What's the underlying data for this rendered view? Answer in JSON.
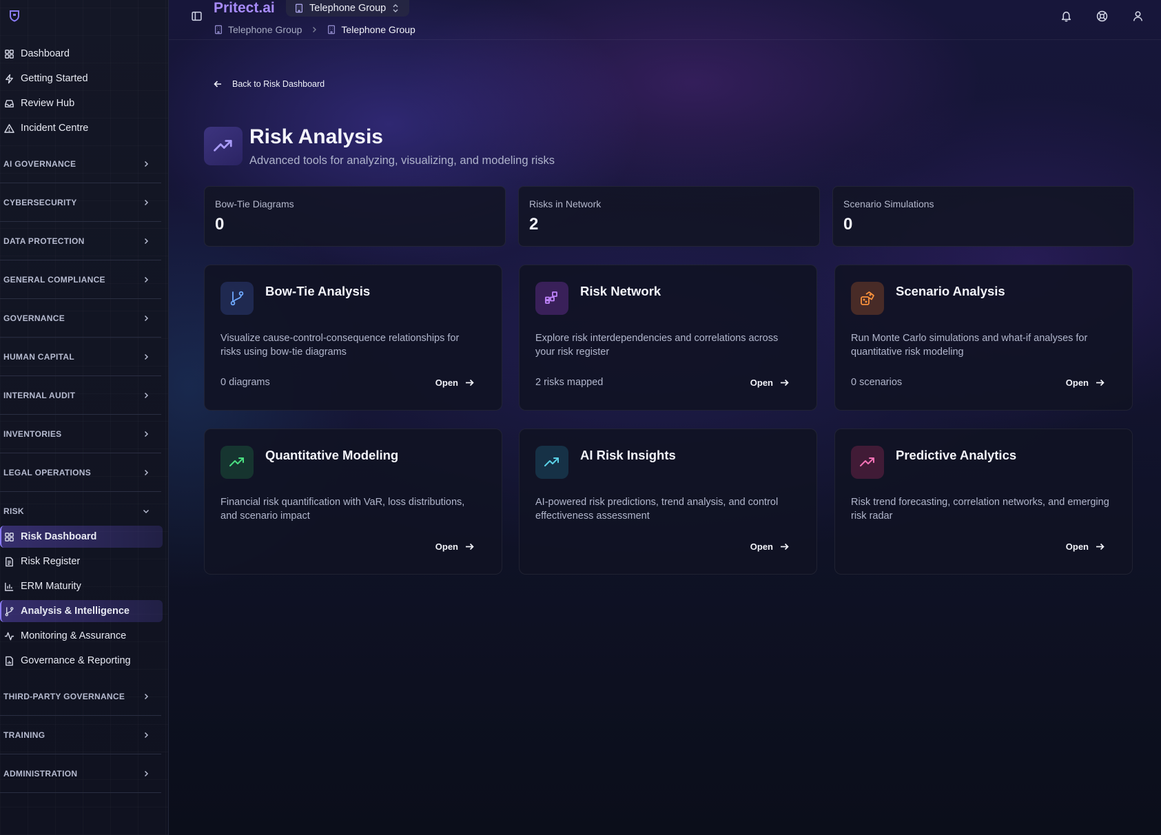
{
  "sidebar": {
    "top_items": [
      {
        "label": "Dashboard",
        "icon": "grid-icon"
      },
      {
        "label": "Getting Started",
        "icon": "zap-icon"
      },
      {
        "label": "Review Hub",
        "icon": "inbox-icon"
      },
      {
        "label": "Incident Centre",
        "icon": "alert-triangle-icon"
      }
    ],
    "sections": [
      "AI GOVERNANCE",
      "CYBERSECURITY",
      "DATA PROTECTION",
      "GENERAL COMPLIANCE",
      "GOVERNANCE",
      "HUMAN CAPITAL",
      "INTERNAL AUDIT",
      "INVENTORIES",
      "LEGAL OPERATIONS",
      "RISK",
      "THIRD-PARTY GOVERNANCE",
      "TRAINING",
      "ADMINISTRATION"
    ],
    "risk_items": [
      {
        "label": "Risk Dashboard",
        "icon": "grid-icon",
        "active": true
      },
      {
        "label": "Risk Register",
        "icon": "file-text-icon"
      },
      {
        "label": "ERM Maturity",
        "icon": "bar-chart-icon"
      },
      {
        "label": "Analysis & Intelligence",
        "icon": "git-branch-icon",
        "active": true
      },
      {
        "label": "Monitoring & Assurance",
        "icon": "activity-icon"
      },
      {
        "label": "Governance & Reporting",
        "icon": "file-chart-icon"
      }
    ]
  },
  "topbar": {
    "brand": "Pritect.ai",
    "org": "Telephone Group",
    "breadcrumb": [
      "Telephone Group",
      "Telephone Group"
    ]
  },
  "page": {
    "back_label": "Back to Risk Dashboard",
    "title": "Risk Analysis",
    "subtitle": "Advanced tools for analyzing, visualizing, and modeling risks"
  },
  "stats": [
    {
      "label": "Bow-Tie Diagrams",
      "value": "0"
    },
    {
      "label": "Risks in Network",
      "value": "2"
    },
    {
      "label": "Scenario Simulations",
      "value": "0"
    }
  ],
  "tools": [
    {
      "title": "Bow-Tie Analysis",
      "desc": "Visualize cause-control-consequence relationships for risks using bow-tie diagrams",
      "count": "0 diagrams",
      "open": "Open",
      "icon": "git-branch-icon",
      "color": "#6ea8fe"
    },
    {
      "title": "Risk Network",
      "desc": "Explore risk interdependencies and correlations across your risk register",
      "count": "2 risks mapped",
      "open": "Open",
      "icon": "network-icon",
      "color": "#c084fc"
    },
    {
      "title": "Scenario Analysis",
      "desc": "Run Monte Carlo simulations and what-if analyses for quantitative risk modeling",
      "count": "0 scenarios",
      "open": "Open",
      "icon": "dices-icon",
      "color": "#fb923c"
    },
    {
      "title": "Quantitative Modeling",
      "desc": "Financial risk quantification with VaR, loss distributions, and scenario impact",
      "count": "",
      "open": "Open",
      "icon": "trending-up-icon",
      "color": "#4ade80"
    },
    {
      "title": "AI Risk Insights",
      "desc": "AI-powered risk predictions, trend analysis, and control effectiveness assessment",
      "count": "",
      "open": "Open",
      "icon": "trending-up-icon",
      "color": "#5ad1e6"
    },
    {
      "title": "Predictive Analytics",
      "desc": "Risk trend forecasting, correlation networks, and emerging risk radar",
      "count": "",
      "open": "Open",
      "icon": "trending-up-icon",
      "color": "#f472b6"
    }
  ],
  "colors": {
    "accent": "#a78bfa",
    "active_nav": "#8b7cf6"
  }
}
